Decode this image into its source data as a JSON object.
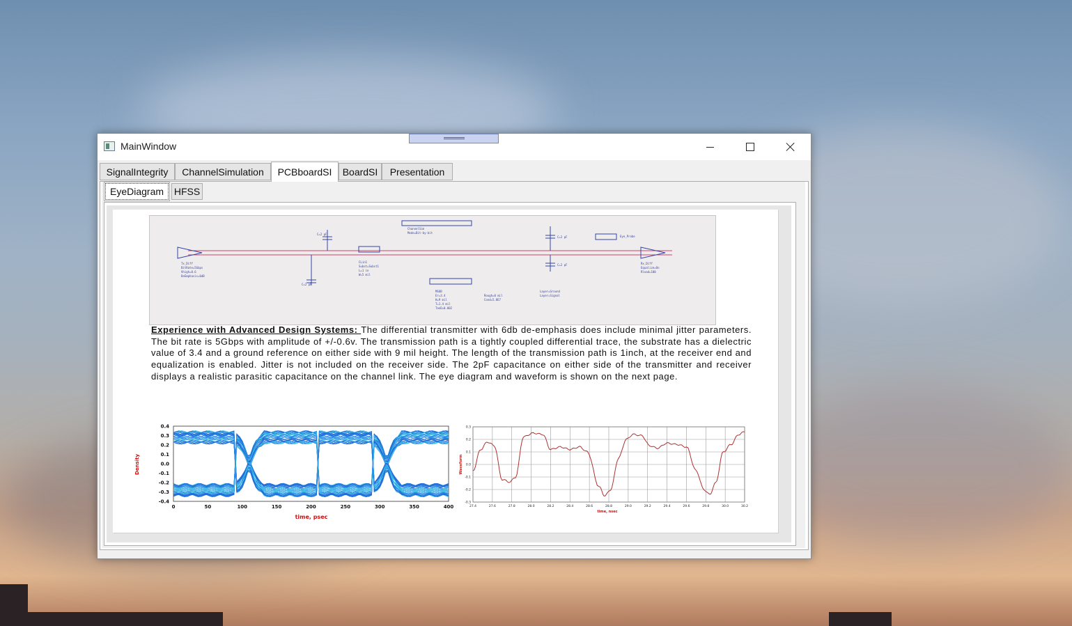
{
  "window": {
    "title": "MainWindow",
    "controls": {
      "minimize": "minimize",
      "maximize": "maximize",
      "close": "close"
    }
  },
  "tabs": [
    {
      "label": "SignalIntegrity",
      "active": false
    },
    {
      "label": "ChannelSimulation",
      "active": false
    },
    {
      "label": "PCBboardSI",
      "active": true
    },
    {
      "label": "BoardSI",
      "active": false
    },
    {
      "label": "Presentation",
      "active": false
    }
  ],
  "subtabs": [
    {
      "label": "EyeDiagram",
      "active": true
    },
    {
      "label": "HFSS",
      "active": false
    }
  ],
  "document": {
    "heading": "Experience with Advanced Design Systems: ",
    "body": "The differential transmitter with 6db de-emphasis does include minimal jitter parameters. The bit rate is 5Gbps with amplitude of +/-0.6v. The transmission path is a tightly coupled differential trace, the substrate has a dielectric value of 3.4 and a ground reference on either side with 9 mil height. The length of the transmission path is 1inch, at the receiver end and equalization is enabled.  Jitter is not included on the receiver side.  The 2pF capacitance on either side of the transmitter and receiver displays a realistic parasitic capacitance on the channel link.   The eye diagram and waveform is shown on the next page."
  },
  "eye_plot": {
    "ylabel": "Density",
    "xlabel": "time, psec",
    "x_ticks": [
      "0",
      "50",
      "100",
      "150",
      "200",
      "250",
      "300",
      "350",
      "400"
    ],
    "y_ticks": [
      "0.4",
      "0.3",
      "0.2",
      "0.1",
      "0.0",
      "-0.1",
      "-0.2",
      "-0.3",
      "-0.4"
    ],
    "colors": {
      "eye": "#1e6fd9",
      "eye_light": "#40c8e8",
      "label": "#d01010"
    }
  },
  "wave_plot": {
    "ylabel": "Waveform",
    "xlabel": "time, nsec",
    "x_ticks": [
      "27.4",
      "27.6",
      "27.8",
      "28.0",
      "28.2",
      "28.4",
      "28.6",
      "28.8",
      "29.0",
      "29.2",
      "29.4",
      "29.6",
      "29.8",
      "30.0",
      "30.2"
    ],
    "y_ticks": [
      "0.3",
      "0.2",
      "0.1",
      "0.0",
      "-0.1",
      "-0.2",
      "-0.3"
    ],
    "colors": {
      "line": "#b03030",
      "grid": "#9a9a9a"
    }
  }
}
